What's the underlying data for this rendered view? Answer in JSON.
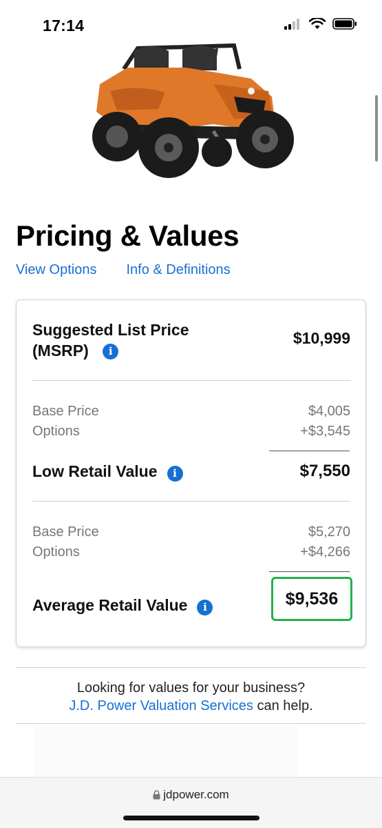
{
  "status_bar": {
    "time": "17:14"
  },
  "page": {
    "title": "Pricing & Values",
    "links": {
      "view_options": "View Options",
      "info_definitions": "Info & Definitions"
    }
  },
  "card": {
    "msrp": {
      "label_line1": "Suggested List Price",
      "label_line2": "(MSRP)",
      "value": "$10,999"
    },
    "low": {
      "base_label": "Base Price",
      "base_value": "$4,005",
      "options_label": "Options",
      "options_value": "+$3,545",
      "label": "Low Retail Value",
      "value": "$7,550"
    },
    "average": {
      "base_label": "Base Price",
      "base_value": "$5,270",
      "options_label": "Options",
      "options_value": "+$4,266",
      "label": "Average Retail Value",
      "value": "$9,536"
    },
    "info_glyph": "i"
  },
  "business": {
    "line1": "Looking for values for your business?",
    "link": "J.D. Power Valuation Services",
    "line2_suffix": " can help."
  },
  "browser": {
    "url": "jdpower.com"
  },
  "colors": {
    "link": "#1670d2",
    "highlight": "#22b14c",
    "vehicle": "#e0782a"
  }
}
